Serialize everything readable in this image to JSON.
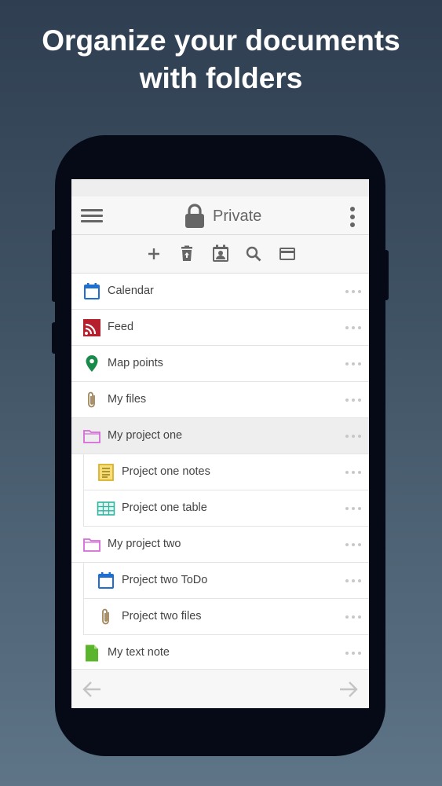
{
  "promo": {
    "line1": "Organize your documents",
    "line2": "with folders"
  },
  "appbar": {
    "title": "Private",
    "title_icon": "lock-icon",
    "menu_icon": "hamburger-menu-icon",
    "overflow_icon": "kebab-menu-icon"
  },
  "toolbar": {
    "icons": [
      "add-icon",
      "delete-icon",
      "contact-icon",
      "search-icon",
      "card-icon"
    ]
  },
  "items": [
    {
      "label": "Calendar",
      "icon": "calendar-icon",
      "level": 0
    },
    {
      "label": "Feed",
      "icon": "rss-feed-icon",
      "level": 0
    },
    {
      "label": "Map points",
      "icon": "map-pin-icon",
      "level": 0
    },
    {
      "label": "My files",
      "icon": "paperclip-icon",
      "level": 0
    },
    {
      "label": "My project one",
      "icon": "folder-icon",
      "level": 0,
      "selected": true
    },
    {
      "label": "Project one notes",
      "icon": "notes-icon",
      "level": 1
    },
    {
      "label": "Project one table",
      "icon": "table-icon",
      "level": 1
    },
    {
      "label": "My project two",
      "icon": "folder-icon",
      "level": 0
    },
    {
      "label": "Project two ToDo",
      "icon": "calendar-icon",
      "level": 1
    },
    {
      "label": "Project two files",
      "icon": "paperclip-icon",
      "level": 1
    },
    {
      "label": "My text note",
      "icon": "text-note-icon",
      "level": 0
    }
  ],
  "bottom_nav": {
    "back_icon": "arrow-left-icon",
    "forward_icon": "arrow-right-icon"
  },
  "colors": {
    "calendar": "#1e6fd0",
    "feed": "#b51f2e",
    "map_pin": "#1a8a4a",
    "paperclip": "#a0855a",
    "folder": "#d36bd8",
    "notes": "#d8b22a",
    "table": "#33b3a0",
    "text_note": "#5bb52c"
  }
}
